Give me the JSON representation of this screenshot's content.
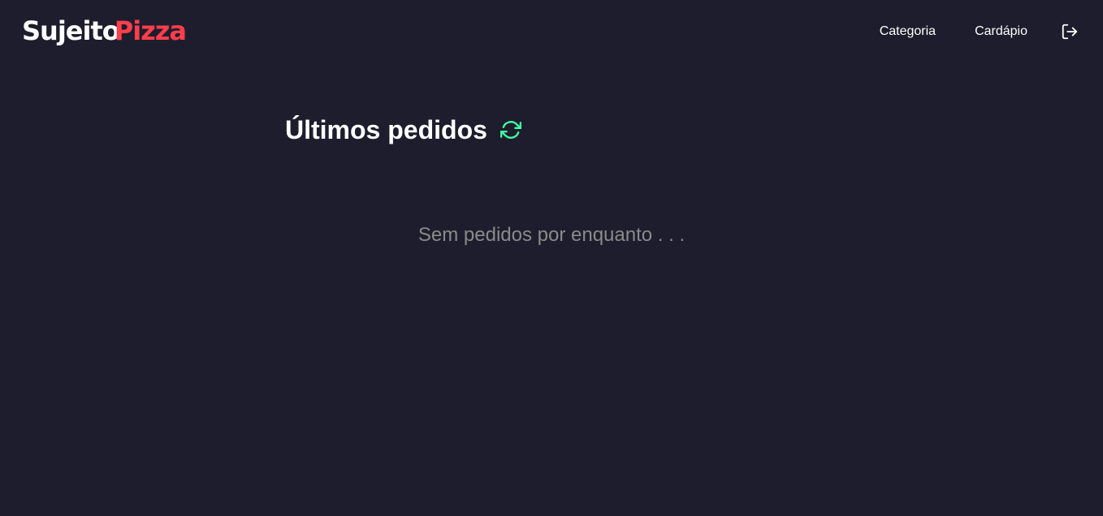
{
  "header": {
    "logo": {
      "part1": "Sujeito",
      "part2": "Pizza"
    },
    "nav": [
      {
        "label": "Categoria"
      },
      {
        "label": "Cardápio"
      }
    ],
    "logout_icon": "logout-icon"
  },
  "main": {
    "title": "Últimos pedidos",
    "refresh_icon": "refresh-icon",
    "empty_message": "Sem pedidos por enquanto . . ."
  },
  "colors": {
    "background": "#1e1d2d",
    "brand_red": "#ff3f4b",
    "accent_green": "#3fffa3",
    "muted_text": "#8a8a8a",
    "text": "#ffffff"
  }
}
